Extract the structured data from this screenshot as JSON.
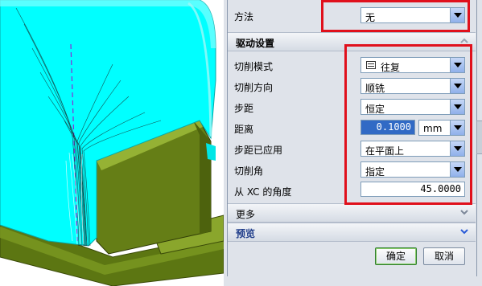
{
  "dialog": {
    "method": {
      "label": "方法",
      "value": "无"
    },
    "drive_section": {
      "title": "驱动设置"
    },
    "cut_pattern": {
      "label": "切削模式",
      "value": "往复",
      "icon": "zigzag-pattern-icon"
    },
    "cut_direction": {
      "label": "切削方向",
      "value": "顺铣"
    },
    "stepover": {
      "label": "步距",
      "value": "恒定"
    },
    "distance": {
      "label": "距离",
      "value": "0.1000",
      "unit": "mm"
    },
    "stepover_applied": {
      "label": "步距已应用",
      "value": "在平面上"
    },
    "cut_angle": {
      "label": "切削角",
      "value": "指定"
    },
    "angle_from_xc": {
      "label": "从 XC 的角度",
      "value": "45.0000"
    },
    "more_section": {
      "title": "更多"
    },
    "preview_section": {
      "title": "预览"
    },
    "ok_label": "确定",
    "cancel_label": "取消"
  },
  "colors": {
    "highlight_box": "#e0101c",
    "part_cyan": "#00ffff",
    "fixture_green": "#6b8a1a",
    "selection_blue": "#316ac5"
  }
}
